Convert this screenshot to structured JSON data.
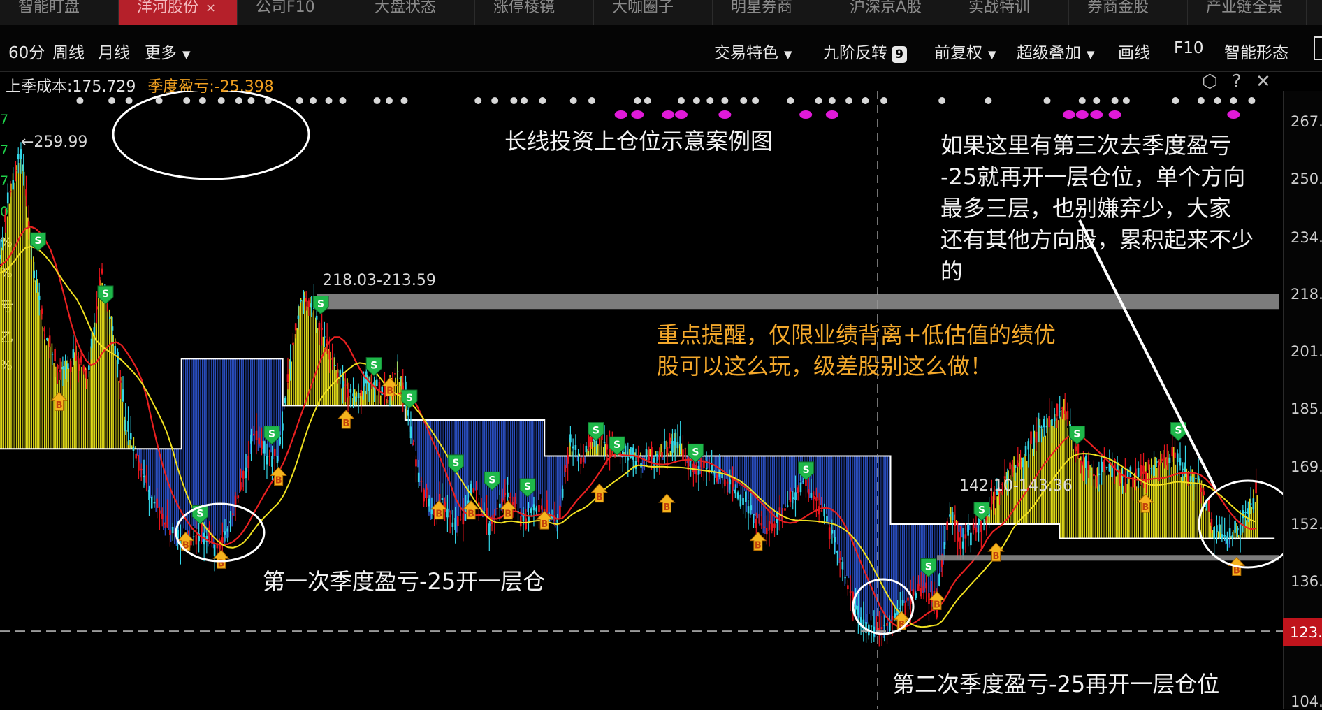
{
  "tabs": [
    {
      "label": "智能盯盘",
      "active": false
    },
    {
      "label": "洋河股份",
      "active": true,
      "close": "×"
    },
    {
      "label": "公司F10",
      "active": false
    },
    {
      "label": "大盘状态",
      "active": false
    },
    {
      "label": "涨停棱镜",
      "active": false
    },
    {
      "label": "大咖圈子",
      "active": false
    },
    {
      "label": "明星券商",
      "active": false
    },
    {
      "label": "沪深京A股",
      "active": false
    },
    {
      "label": "实战特训",
      "active": false
    },
    {
      "label": "券商金股",
      "active": false
    },
    {
      "label": "产业链全景",
      "active": false
    }
  ],
  "toolbar": {
    "periods": [
      "60分",
      "周线",
      "月线"
    ],
    "more": "更多",
    "trade_feature": "交易特色",
    "nine_reversal": "九阶反转",
    "nine_badge": "9",
    "adjust": "前复权",
    "overlay": "超级叠加",
    "draw": "画线",
    "f10": "F10",
    "smart_shape": "智能形态"
  },
  "info": {
    "cost_label": "上季成本:175.729",
    "pnl_label": "季度盈亏:-25.398"
  },
  "corner_icons": [
    "settings-hex-icon",
    "help-icon",
    "close-icon"
  ],
  "annotations": {
    "title": "长线投资上仓位示意案例图",
    "top_right": [
      "如果这里有第三次去季度盈亏",
      "-25就再开一层仓位，单个方向",
      "最多三层，也别嫌弃少，大家",
      "还有其他方向股，累积起来不少",
      "的"
    ],
    "warning": [
      "重点提醒，仅限业绩背离+低估值的绩优",
      "股可以这么玩，级差股别这么做！"
    ],
    "first": "第一次季度盈亏-25开一层仓",
    "second": "第二次季度盈亏-25再开一层仓位",
    "high_label": "←259.99",
    "resistance_label": "218.03-213.59",
    "support_label": "142.10-143.36"
  },
  "colors": {
    "up": "#e8141c",
    "down": "#33d6e8",
    "yellow_hist": "#e8e21a",
    "blue_hist": "#2c52c8",
    "ma_red": "#e82020",
    "ma_yellow": "#f0e020",
    "buy_marker": "#f5b41e",
    "sell_marker": "#1fb84a"
  },
  "left_strip": [
    "7",
    "7",
    "7",
    "0",
    "%",
    "%",
    "亏",
    "乙",
    "%"
  ],
  "chart_data": {
    "type": "candlestick",
    "title": "长线投资上仓位示意案例图",
    "ylim": [
      104.0,
      275.0
    ],
    "yticks": [
      267.9,
      250.9,
      234.0,
      218.0,
      201.0,
      185.1,
      169.0,
      152.0,
      136.0,
      123.0,
      104.0
    ],
    "ytick_labels": [
      "267.",
      "250.",
      "234.",
      "218.",
      "201.",
      "185.",
      "169.",
      "152.",
      "136.",
      "123.",
      "104."
    ],
    "current_price_label": "123.",
    "close_path": [
      [
        0,
        228
      ],
      [
        10,
        245
      ],
      [
        25,
        259.99
      ],
      [
        40,
        225
      ],
      [
        55,
        205
      ],
      [
        70,
        195
      ],
      [
        90,
        200
      ],
      [
        105,
        195
      ],
      [
        120,
        225
      ],
      [
        135,
        205
      ],
      [
        150,
        180
      ],
      [
        165,
        170
      ],
      [
        180,
        160
      ],
      [
        195,
        152
      ],
      [
        210,
        148
      ],
      [
        225,
        148
      ],
      [
        240,
        150
      ],
      [
        255,
        146
      ],
      [
        270,
        150
      ],
      [
        285,
        162
      ],
      [
        300,
        178
      ],
      [
        315,
        172
      ],
      [
        330,
        172
      ],
      [
        345,
        200
      ],
      [
        358,
        218.03
      ],
      [
        370,
        215
      ],
      [
        385,
        205
      ],
      [
        400,
        195
      ],
      [
        420,
        188
      ],
      [
        440,
        194
      ],
      [
        455,
        188
      ],
      [
        470,
        196
      ],
      [
        480,
        190
      ],
      [
        495,
        168
      ],
      [
        510,
        156
      ],
      [
        525,
        160
      ],
      [
        540,
        150
      ],
      [
        560,
        162
      ],
      [
        580,
        152
      ],
      [
        600,
        162
      ],
      [
        620,
        153
      ],
      [
        640,
        158
      ],
      [
        660,
        152
      ],
      [
        675,
        176
      ],
      [
        690,
        171
      ],
      [
        705,
        178
      ],
      [
        720,
        175
      ],
      [
        740,
        172
      ],
      [
        760,
        170
      ],
      [
        780,
        172
      ],
      [
        800,
        177
      ],
      [
        820,
        170
      ],
      [
        840,
        168
      ],
      [
        860,
        165
      ],
      [
        880,
        160
      ],
      [
        900,
        152
      ],
      [
        915,
        150
      ],
      [
        935,
        158
      ],
      [
        950,
        165
      ],
      [
        965,
        160
      ],
      [
        985,
        150
      ],
      [
        1000,
        138
      ],
      [
        1015,
        128
      ],
      [
        1030,
        125
      ],
      [
        1045,
        124
      ],
      [
        1060,
        128
      ],
      [
        1080,
        132
      ],
      [
        1095,
        135
      ],
      [
        1110,
        130
      ],
      [
        1125,
        155
      ],
      [
        1140,
        147
      ],
      [
        1160,
        152
      ],
      [
        1180,
        160
      ],
      [
        1195,
        168
      ],
      [
        1215,
        172
      ],
      [
        1230,
        180
      ],
      [
        1245,
        180
      ],
      [
        1260,
        186
      ],
      [
        1280,
        170
      ],
      [
        1300,
        166
      ],
      [
        1315,
        170
      ],
      [
        1330,
        166
      ],
      [
        1350,
        166
      ],
      [
        1370,
        170
      ],
      [
        1390,
        172
      ],
      [
        1405,
        167
      ],
      [
        1420,
        165
      ],
      [
        1440,
        150
      ],
      [
        1460,
        148
      ],
      [
        1475,
        155
      ],
      [
        1490,
        162
      ]
    ],
    "horizontal_bands": [
      {
        "label": "218.03-213.59",
        "from": 213.59,
        "to": 218.03
      },
      {
        "label": "142.10-143.36",
        "from": 142.1,
        "to": 143.36
      }
    ],
    "cost_steps": [
      {
        "x_from": 0,
        "x_to": 215,
        "level": 174
      },
      {
        "x_from": 215,
        "x_to": 335,
        "level": 199
      },
      {
        "x_from": 335,
        "x_to": 480,
        "level": 186
      },
      {
        "x_from": 480,
        "x_to": 645,
        "level": 182
      },
      {
        "x_from": 645,
        "x_to": 1055,
        "level": 172
      },
      {
        "x_from": 1055,
        "x_to": 1255,
        "level": 152
      },
      {
        "x_from": 1255,
        "x_to": 1510,
        "level": 148
      }
    ],
    "buy_signals": [
      {
        "x": 70,
        "y": 187
      },
      {
        "x": 220,
        "y": 147
      },
      {
        "x": 262,
        "y": 142
      },
      {
        "x": 330,
        "y": 166
      },
      {
        "x": 410,
        "y": 182
      },
      {
        "x": 462,
        "y": 191
      },
      {
        "x": 520,
        "y": 156
      },
      {
        "x": 558,
        "y": 156
      },
      {
        "x": 602,
        "y": 156
      },
      {
        "x": 645,
        "y": 153
      },
      {
        "x": 710,
        "y": 161
      },
      {
        "x": 790,
        "y": 158
      },
      {
        "x": 898,
        "y": 147
      },
      {
        "x": 1068,
        "y": 126
      },
      {
        "x": 1110,
        "y": 131
      },
      {
        "x": 1180,
        "y": 144
      },
      {
        "x": 1357,
        "y": 158
      },
      {
        "x": 1465,
        "y": 140
      }
    ],
    "sell_signals": [
      {
        "x": 45,
        "y": 233
      },
      {
        "x": 125,
        "y": 218
      },
      {
        "x": 237,
        "y": 155
      },
      {
        "x": 322,
        "y": 178
      },
      {
        "x": 380,
        "y": 215
      },
      {
        "x": 443,
        "y": 197
      },
      {
        "x": 485,
        "y": 188
      },
      {
        "x": 540,
        "y": 170
      },
      {
        "x": 583,
        "y": 165
      },
      {
        "x": 625,
        "y": 163
      },
      {
        "x": 706,
        "y": 179
      },
      {
        "x": 731,
        "y": 175
      },
      {
        "x": 824,
        "y": 173
      },
      {
        "x": 955,
        "y": 168
      },
      {
        "x": 1100,
        "y": 140
      },
      {
        "x": 1163,
        "y": 156
      },
      {
        "x": 1276,
        "y": 178
      },
      {
        "x": 1396,
        "y": 179
      }
    ]
  }
}
